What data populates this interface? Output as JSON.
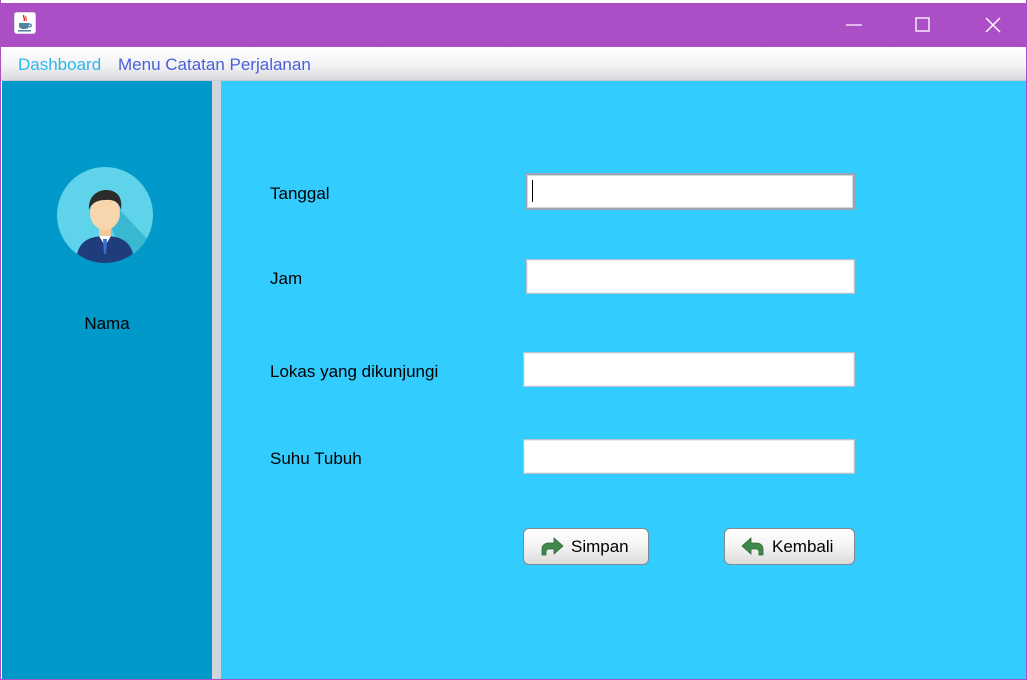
{
  "window": {
    "app_icon": "java-coffee-cup-icon",
    "controls": [
      "minimize-icon",
      "maximize-icon",
      "close-icon"
    ]
  },
  "menu": {
    "dashboard": "Dashboard",
    "catatan": "Menu Catatan Perjalanan"
  },
  "sidebar": {
    "avatar_icon": "user-avatar-icon",
    "name": "Nama"
  },
  "form": {
    "tanggal_label": "Tanggal",
    "tanggal_value": "",
    "jam_label": "Jam",
    "jam_value": "",
    "lokasi_label": "Lokas yang dikunjungi",
    "lokasi_value": "",
    "suhu_label": "Suhu Tubuh",
    "suhu_value": ""
  },
  "buttons": {
    "simpan": "Simpan",
    "simpan_icon": "forward-arrow-icon",
    "kembali": "Kembali",
    "kembali_icon": "back-arrow-icon"
  },
  "colors": {
    "titlebar": "#ac4fc6",
    "sidebar": "#0099c9",
    "content": "#33ccff",
    "menu_dashboard": "#2db7ec",
    "menu_catatan": "#4a5fd8"
  }
}
